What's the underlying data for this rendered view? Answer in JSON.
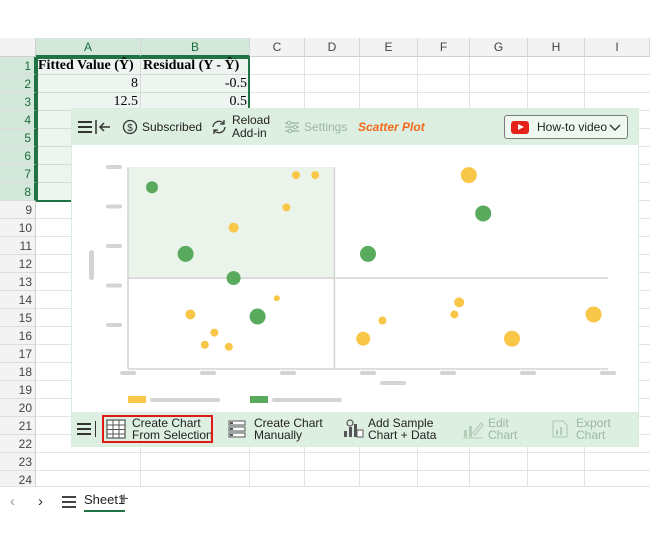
{
  "spreadsheet": {
    "columns": [
      "A",
      "B",
      "C",
      "D",
      "E",
      "F",
      "G",
      "H",
      "I"
    ],
    "rows": [
      "1",
      "2",
      "3",
      "4",
      "5",
      "6",
      "7",
      "8",
      "9",
      "10",
      "11",
      "12",
      "13",
      "14",
      "15",
      "16",
      "17",
      "18",
      "19",
      "20",
      "21",
      "22",
      "23",
      "24"
    ],
    "cells": {
      "a1": "Fitted Value (Ŷ)",
      "b1": "Residual (Y - Ŷ)",
      "a2": "8",
      "b2": "-0.5",
      "a3": "12.5",
      "b3": "0.5"
    }
  },
  "addin": {
    "toolbar": {
      "subscribed": "Subscribed",
      "reload_line1": "Reload",
      "reload_line2": "Add-in",
      "settings": "Settings",
      "title": "Scatter Plot",
      "howto": "How-to video"
    },
    "bottom": {
      "create_selection_line1": "Create Chart",
      "create_selection_line2": "From Selection",
      "create_manual_line1": "Create Chart",
      "create_manual_line2": "Manually",
      "sample_line1": "Add Sample",
      "sample_line2": "Chart + Data",
      "edit_line1": "Edit",
      "edit_line2": "Chart",
      "export_line1": "Export",
      "export_line2": "Chart"
    }
  },
  "tabs": {
    "sheet_name": "Sheet1",
    "add_symbol": "+"
  },
  "colors": {
    "excel_green": "#217346",
    "addin_bar": "#dcefe1",
    "title_orange": "#f26a1b",
    "dot_green": "#5aaa5e",
    "dot_yellow": "#f9c748",
    "highlight_red": "#e01818"
  },
  "chart_data": {
    "type": "scatter",
    "title": "",
    "xlabel": "",
    "ylabel": "",
    "xlim": [
      0,
      100
    ],
    "ylim": [
      0,
      100
    ],
    "grid": false,
    "legend": "bottom-left",
    "quadrant_divider": {
      "x": 43,
      "y": 45
    },
    "series": [
      {
        "color": "#5aaa5e",
        "points": [
          {
            "x": 5,
            "y": 90,
            "s": 6
          },
          {
            "x": 12,
            "y": 57,
            "s": 8
          },
          {
            "x": 22,
            "y": 45,
            "s": 7
          },
          {
            "x": 27,
            "y": 26,
            "s": 8
          },
          {
            "x": 50,
            "y": 57,
            "s": 8
          },
          {
            "x": 74,
            "y": 77,
            "s": 8
          }
        ]
      },
      {
        "color": "#f9c748",
        "points": [
          {
            "x": 35,
            "y": 96,
            "s": 4
          },
          {
            "x": 39,
            "y": 96,
            "s": 4
          },
          {
            "x": 33,
            "y": 80,
            "s": 4
          },
          {
            "x": 22,
            "y": 70,
            "s": 5
          },
          {
            "x": 31,
            "y": 35,
            "s": 3
          },
          {
            "x": 13,
            "y": 27,
            "s": 5
          },
          {
            "x": 18,
            "y": 18,
            "s": 4
          },
          {
            "x": 16,
            "y": 12,
            "s": 4
          },
          {
            "x": 21,
            "y": 11,
            "s": 4
          },
          {
            "x": 71,
            "y": 96,
            "s": 8
          },
          {
            "x": 69,
            "y": 33,
            "s": 5
          },
          {
            "x": 68,
            "y": 27,
            "s": 4
          },
          {
            "x": 53,
            "y": 24,
            "s": 4
          },
          {
            "x": 49,
            "y": 15,
            "s": 7
          },
          {
            "x": 80,
            "y": 15,
            "s": 8
          },
          {
            "x": 97,
            "y": 27,
            "s": 8
          }
        ]
      }
    ]
  }
}
